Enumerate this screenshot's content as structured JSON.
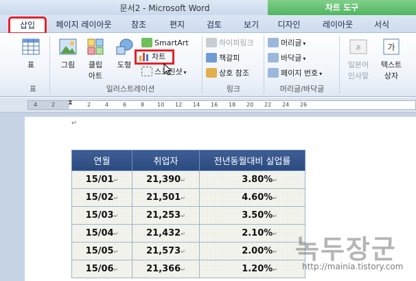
{
  "window": {
    "title": "문서2 - Microsoft Word",
    "context_tab_group": "차트 도구"
  },
  "tabs": [
    "삽입",
    "페이지 레이아웃",
    "참조",
    "편지",
    "검토",
    "보기",
    "디자인",
    "레이아웃",
    "서식"
  ],
  "active_tab": "삽입",
  "ribbon": {
    "table_group": {
      "button": "표",
      "label": "표"
    },
    "illustrations": {
      "picture": "그림",
      "clipart_line1": "클립",
      "clipart_line2": "아트",
      "shapes": "도형",
      "smartart": "SmartArt",
      "chart": "차트",
      "screenshot": "스크린샷",
      "label": "일러스트레이션"
    },
    "links": {
      "hyperlink": "하이퍼링크",
      "bookmark": "책갈피",
      "crossref": "상호 참조",
      "label": "링크"
    },
    "header_footer": {
      "header": "머리글",
      "footer": "바닥글",
      "page_number": "페이지 번호",
      "label": "머리글/바닥글"
    },
    "text": {
      "asian_line1": "일본어",
      "asian_line2": "인사말",
      "textbox_line1": "텍스트",
      "textbox_line2": "상자"
    }
  },
  "ruler": {
    "numbers": [
      "4",
      "2",
      "2",
      "4",
      "6",
      "8",
      "10",
      "12",
      "14",
      "16",
      "18",
      "20",
      "22",
      "24",
      "26"
    ]
  },
  "document": {
    "paragraph_mark": "↵",
    "cell_mark": "↵",
    "table": {
      "headers": [
        "연월",
        "취업자",
        "전년동월대비 실업률"
      ],
      "rows": [
        [
          "15/01",
          "21,390",
          "3.80%"
        ],
        [
          "15/02",
          "21,501",
          "4.60%"
        ],
        [
          "15/03",
          "21,253",
          "3.50%"
        ],
        [
          "15/04",
          "21,432",
          "2.10%"
        ],
        [
          "15/05",
          "21,573",
          "2.00%"
        ],
        [
          "15/06",
          "21,366",
          "1.20%"
        ]
      ]
    }
  },
  "watermark": {
    "text": "녹두장군",
    "url": "http://mainia.tistory.com"
  },
  "colors": {
    "accent_red": "#e5202a",
    "header_blue": "#2b4a7f",
    "context_green": "#52b55f"
  }
}
